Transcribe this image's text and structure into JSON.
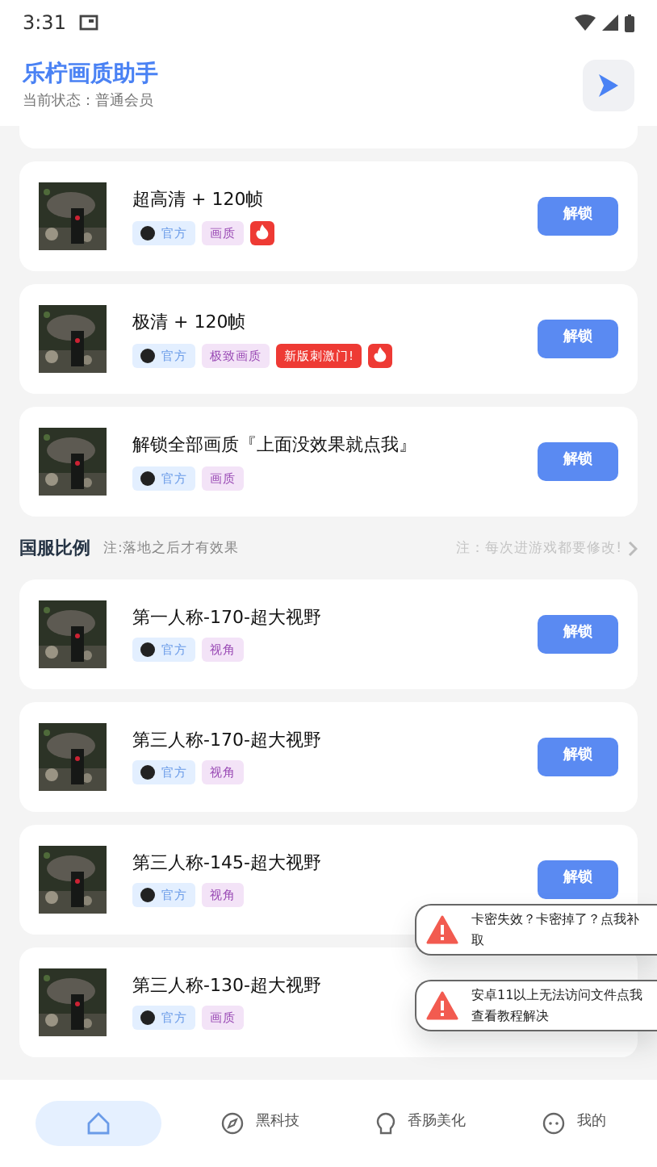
{
  "status_bar": {
    "time": "3:31"
  },
  "header": {
    "title": "乐柠画质助手",
    "subtitle": "当前状态：普通会员"
  },
  "quality_items": [
    {
      "title": "超高清 + 120帧",
      "tags": [
        {
          "kind": "official",
          "text": "官方"
        },
        {
          "kind": "label",
          "text": "画质"
        },
        {
          "kind": "fire"
        }
      ],
      "button": "解锁"
    },
    {
      "title": "极清 + 120帧",
      "tags": [
        {
          "kind": "official",
          "text": "官方"
        },
        {
          "kind": "label",
          "text": "极致画质"
        },
        {
          "kind": "hot",
          "text": "新版刺激门!"
        },
        {
          "kind": "fire"
        }
      ],
      "button": "解锁"
    },
    {
      "title": "解锁全部画质『上面没效果就点我』",
      "tags": [
        {
          "kind": "official",
          "text": "官方"
        },
        {
          "kind": "label",
          "text": "画质"
        }
      ],
      "button": "解锁"
    }
  ],
  "section": {
    "title": "国服比例",
    "note": "注:落地之后才有效果",
    "hint": "注：每次进游戏都要修改!"
  },
  "ratio_items": [
    {
      "title": "第一人称-170-超大视野",
      "tags": [
        {
          "kind": "official",
          "text": "官方"
        },
        {
          "kind": "label",
          "text": "视角"
        }
      ],
      "button": "解锁"
    },
    {
      "title": "第三人称-170-超大视野",
      "tags": [
        {
          "kind": "official",
          "text": "官方"
        },
        {
          "kind": "label",
          "text": "视角"
        }
      ],
      "button": "解锁"
    },
    {
      "title": "第三人称-145-超大视野",
      "tags": [
        {
          "kind": "official",
          "text": "官方"
        },
        {
          "kind": "label",
          "text": "视角"
        }
      ],
      "button": "解锁"
    },
    {
      "title": "第三人称-130-超大视野",
      "tags": [
        {
          "kind": "official",
          "text": "官方"
        },
        {
          "kind": "label",
          "text": "画质"
        }
      ]
    }
  ],
  "toasts": [
    "卡密失效？卡密掉了？点我补取",
    "安卓11以上无法访问文件点我查看教程解决"
  ],
  "bottom_nav": [
    {
      "selected": true
    },
    {
      "label": "黑科技",
      "selected": false
    },
    {
      "label": "香肠美化",
      "selected": false
    },
    {
      "label": "我的",
      "selected": false
    }
  ]
}
